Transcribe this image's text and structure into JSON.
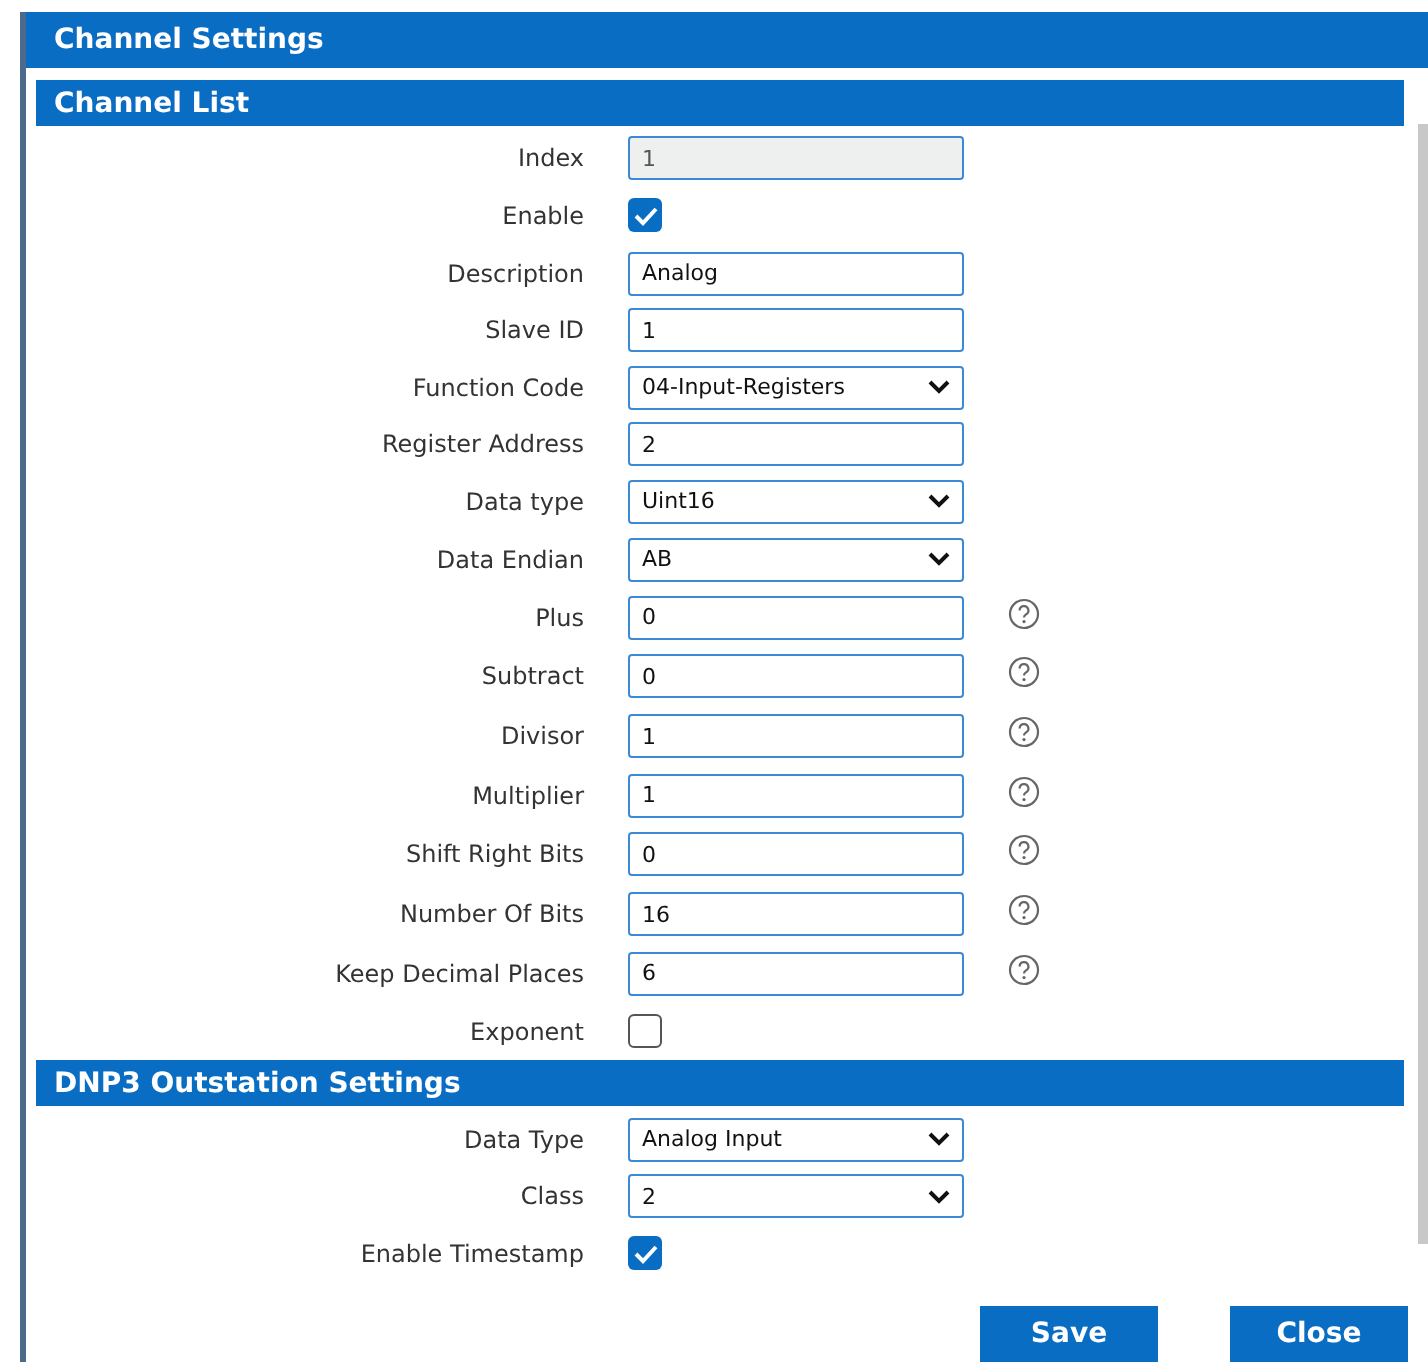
{
  "dialog": {
    "title": "Channel Settings"
  },
  "sections": [
    {
      "title": "Channel List",
      "rows": [
        {
          "label": "Index",
          "kind": "text",
          "value": "1",
          "disabled": true,
          "help": false
        },
        {
          "label": "Enable",
          "kind": "checkbox",
          "checked": true
        },
        {
          "label": "Description",
          "kind": "text",
          "value": "Analog",
          "disabled": false,
          "help": false
        },
        {
          "label": "Slave ID",
          "kind": "text",
          "value": "1",
          "disabled": false,
          "help": false
        },
        {
          "label": "Function Code",
          "kind": "select",
          "value": "04-Input-Registers",
          "help": false
        },
        {
          "label": "Register Address",
          "kind": "text",
          "value": "2",
          "disabled": false,
          "help": false
        },
        {
          "label": "Data type",
          "kind": "select",
          "value": "Uint16",
          "help": false
        },
        {
          "label": "Data Endian",
          "kind": "select",
          "value": "AB",
          "help": false
        },
        {
          "label": "Plus",
          "kind": "text",
          "value": "0",
          "disabled": false,
          "help": true
        },
        {
          "label": "Subtract",
          "kind": "text",
          "value": "0",
          "disabled": false,
          "help": true
        },
        {
          "label": "Divisor",
          "kind": "text",
          "value": "1",
          "disabled": false,
          "help": true
        },
        {
          "label": "Multiplier",
          "kind": "text",
          "value": "1",
          "disabled": false,
          "help": true
        },
        {
          "label": "Shift Right Bits",
          "kind": "text",
          "value": "0",
          "disabled": false,
          "help": true
        },
        {
          "label": "Number Of Bits",
          "kind": "text",
          "value": "16",
          "disabled": false,
          "help": true
        },
        {
          "label": "Keep Decimal Places",
          "kind": "text",
          "value": "6",
          "disabled": false,
          "help": true
        },
        {
          "label": "Exponent",
          "kind": "checkbox",
          "checked": false
        }
      ]
    },
    {
      "title": "DNP3 Outstation Settings",
      "rows": [
        {
          "label": "Data Type",
          "kind": "select",
          "value": "Analog Input",
          "help": false
        },
        {
          "label": "Class",
          "kind": "select",
          "value": "2",
          "help": false
        },
        {
          "label": "Enable Timestamp",
          "kind": "checkbox",
          "checked": true
        }
      ]
    }
  ],
  "buttons": [
    "Save",
    "Close"
  ]
}
